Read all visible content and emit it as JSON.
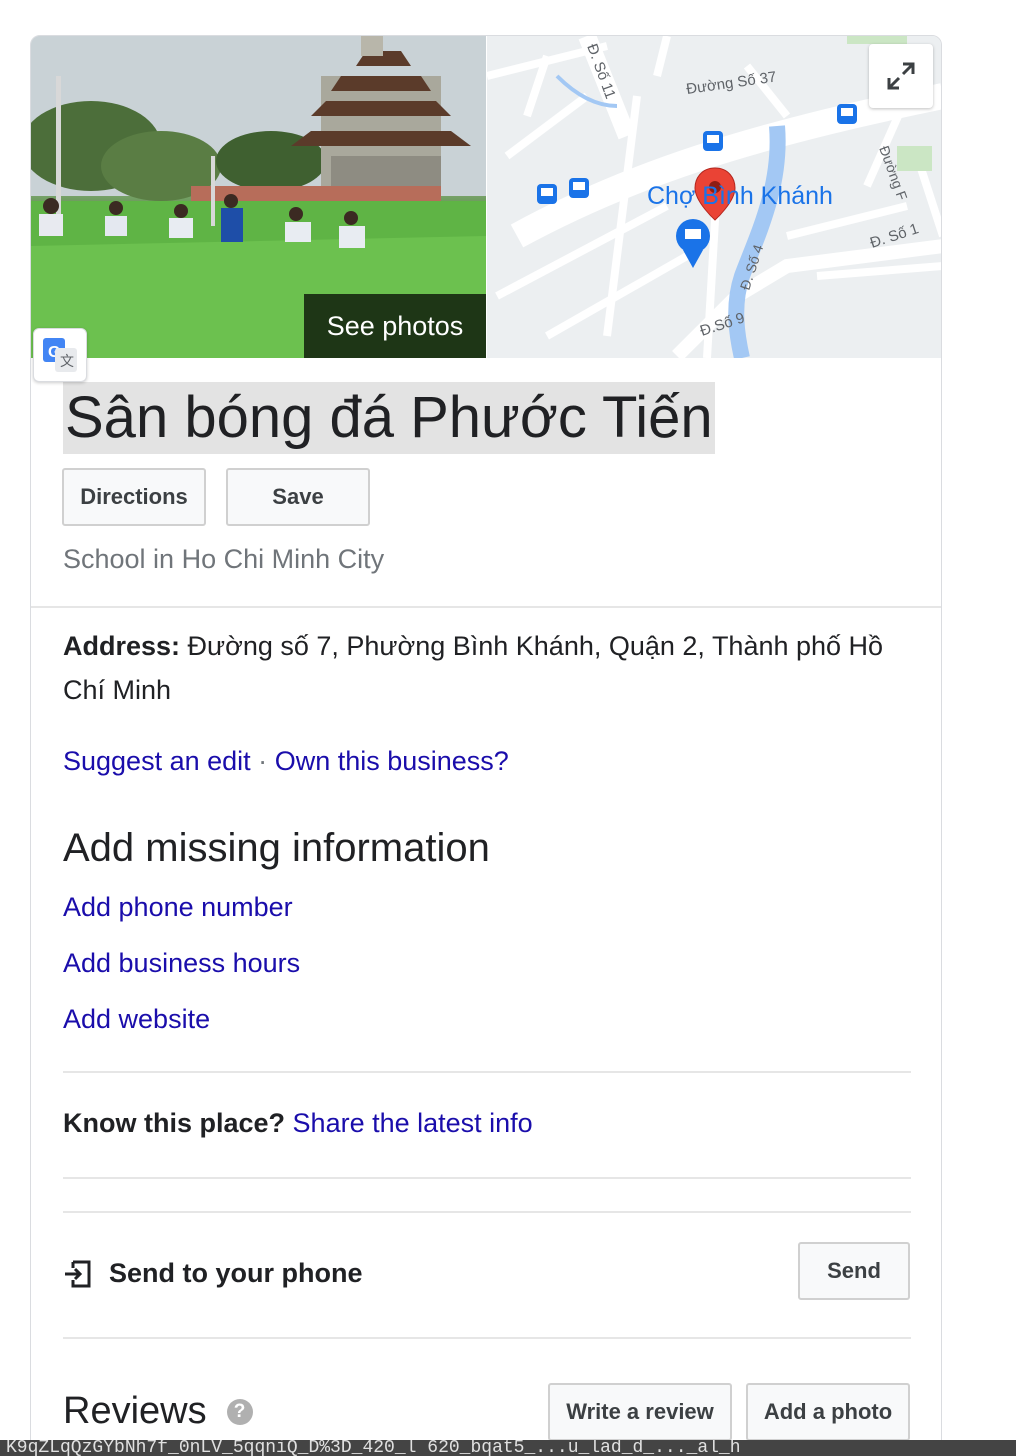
{
  "hero": {
    "see_photos_label": "See photos",
    "map_labels": {
      "street_37": "Đường Số 37",
      "street_11": "Đ. Số 11",
      "market": "Chợ Bình Khánh",
      "street_f": "Đường F",
      "street_1": "Đ. Số 1",
      "street_4": "Đ. Số 4",
      "street_9": "Đ.Số 9"
    }
  },
  "place": {
    "title": "Sân bóng đá Phước Tiến",
    "category": "School in Ho Chi Minh City"
  },
  "actions": {
    "directions_label": "Directions",
    "save_label": "Save"
  },
  "address": {
    "label": "Address:",
    "value": "Đường số 7, Phường Bình Khánh, Quận 2, Thành phố Hồ Chí Minh"
  },
  "edit_links": {
    "suggest_edit": "Suggest an edit",
    "separator": "·",
    "own_business": "Own this business?"
  },
  "missing_info": {
    "title": "Add missing information",
    "links": [
      "Add phone number",
      "Add business hours",
      "Add website"
    ]
  },
  "know_place": {
    "question": "Know this place?",
    "link": "Share the latest info"
  },
  "send": {
    "label": "Send to your phone",
    "button": "Send"
  },
  "reviews": {
    "title": "Reviews",
    "help": "?",
    "write_review": "Write a review",
    "add_photo": "Add a photo"
  },
  "status_bar": {
    "text": "K9qZLqQzGYbNh7f_0nLV_5qqniQ_D%3D_420_l 620_bqat5_...u_lad_d_..._al_h"
  },
  "colors": {
    "link": "#1a0dab",
    "title_highlight": "#e3e3e3",
    "pin": "#ea4335",
    "map_poi": "#1a73e8"
  },
  "icons": {
    "expand": "expand-arrows-icon",
    "translate": "google-translate-icon",
    "send": "send-to-device-icon",
    "help": "help-circle-icon"
  }
}
